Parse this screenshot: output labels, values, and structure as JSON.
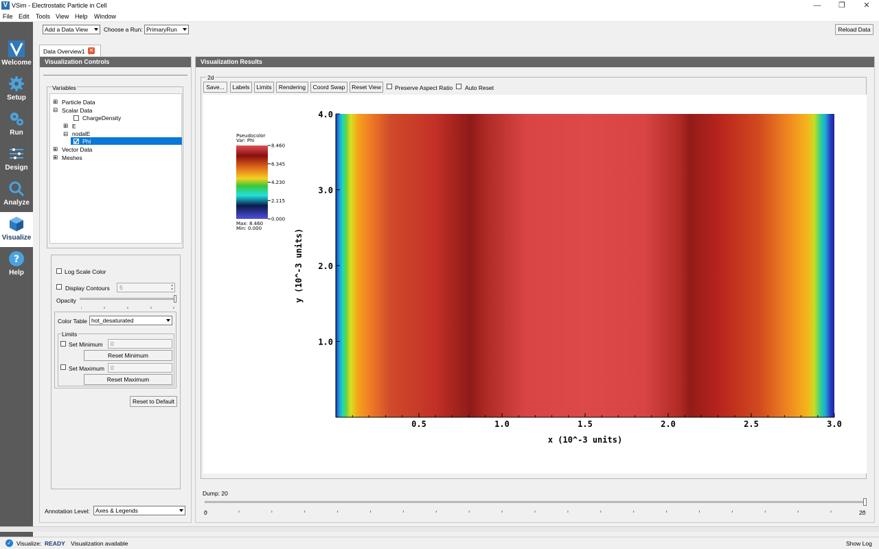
{
  "window": {
    "title": "VSim - Electrostatic Particle in Cell",
    "minimize": "—",
    "restore": "❐",
    "close": "✕"
  },
  "menu": [
    "File",
    "Edit",
    "Tools",
    "View",
    "Help",
    "Window"
  ],
  "sidebar": {
    "items": [
      {
        "label": "Welcome",
        "icon": "vsim-logo-icon"
      },
      {
        "label": "Setup",
        "icon": "gear-icon"
      },
      {
        "label": "Run",
        "icon": "gears-icon"
      },
      {
        "label": "Design",
        "icon": "design-icon"
      },
      {
        "label": "Analyze",
        "icon": "magnifier-icon"
      },
      {
        "label": "Visualize",
        "icon": "cube-icon",
        "active": true
      },
      {
        "label": "Help",
        "icon": "help-icon"
      }
    ]
  },
  "toolbar": {
    "add_view": "Add a Data View",
    "choose_run_label": "Choose a Run:",
    "run_value": "PrimaryRun",
    "reload": "Reload Data"
  },
  "tab": {
    "label": "Data Overview1"
  },
  "controls": {
    "header": "Visualization Controls",
    "variables_title": "Variables",
    "tree": {
      "particle": "Particle Data",
      "scalar": "Scalar Data",
      "charge": "ChargeDensity",
      "e": "E",
      "nodale": "nodalE",
      "phi": "Phi",
      "vector": "Vector Data",
      "meshes": "Meshes"
    },
    "log_scale": "Log Scale Color",
    "display_contours": "Display Contours",
    "contours_value": "5",
    "opacity": "Opacity",
    "color_table_label": "Color Table",
    "color_table_value": "hot_desaturated",
    "limits_title": "Limits",
    "set_min": "Set Minimum",
    "min_value": "0",
    "reset_min": "Reset Minimum",
    "set_max": "Set Maximum",
    "max_value": "0",
    "reset_max": "Reset Maximum",
    "reset_default": "Reset to Default",
    "annotation_label": "Annotation Level:",
    "annotation_value": "Axes & Legends"
  },
  "results": {
    "header": "Visualization Results",
    "group": "2d",
    "buttons": [
      "Save...",
      "Labels",
      "Limits",
      "Rendering",
      "Coord Swap",
      "Reset View"
    ],
    "preserve_aspect": "Preserve Aspect Ratio",
    "auto_reset": "Auto Reset",
    "dump_label": "Dump: 20",
    "dump_min": "0",
    "dump_max": "20",
    "dump_value": 20
  },
  "chart_data": {
    "type": "heatmap",
    "variable": "Phi",
    "legend_title": "Pseudocolor",
    "legend_var": "Var: Phi",
    "legend_ticks": [
      "8.460",
      "6.345",
      "4.230",
      "2.115",
      "0.000"
    ],
    "legend_max": "Max:  8.460",
    "legend_min": "Min:  0.000",
    "xlabel": "x (10^-3 units)",
    "ylabel": "y (10^-3 units)",
    "x_ticks": [
      "0.5",
      "1.0",
      "1.5",
      "2.0",
      "2.5",
      "3.0"
    ],
    "y_ticks": [
      "1.0",
      "2.0",
      "3.0",
      "4.0"
    ],
    "xlim": [
      0.0,
      3.0
    ],
    "ylim": [
      0.0,
      4.0
    ],
    "colormap": "hot_desaturated"
  },
  "status": {
    "label": "Visualize:",
    "state": "READY",
    "message": "Visualization available",
    "show_log": "Show Log"
  }
}
